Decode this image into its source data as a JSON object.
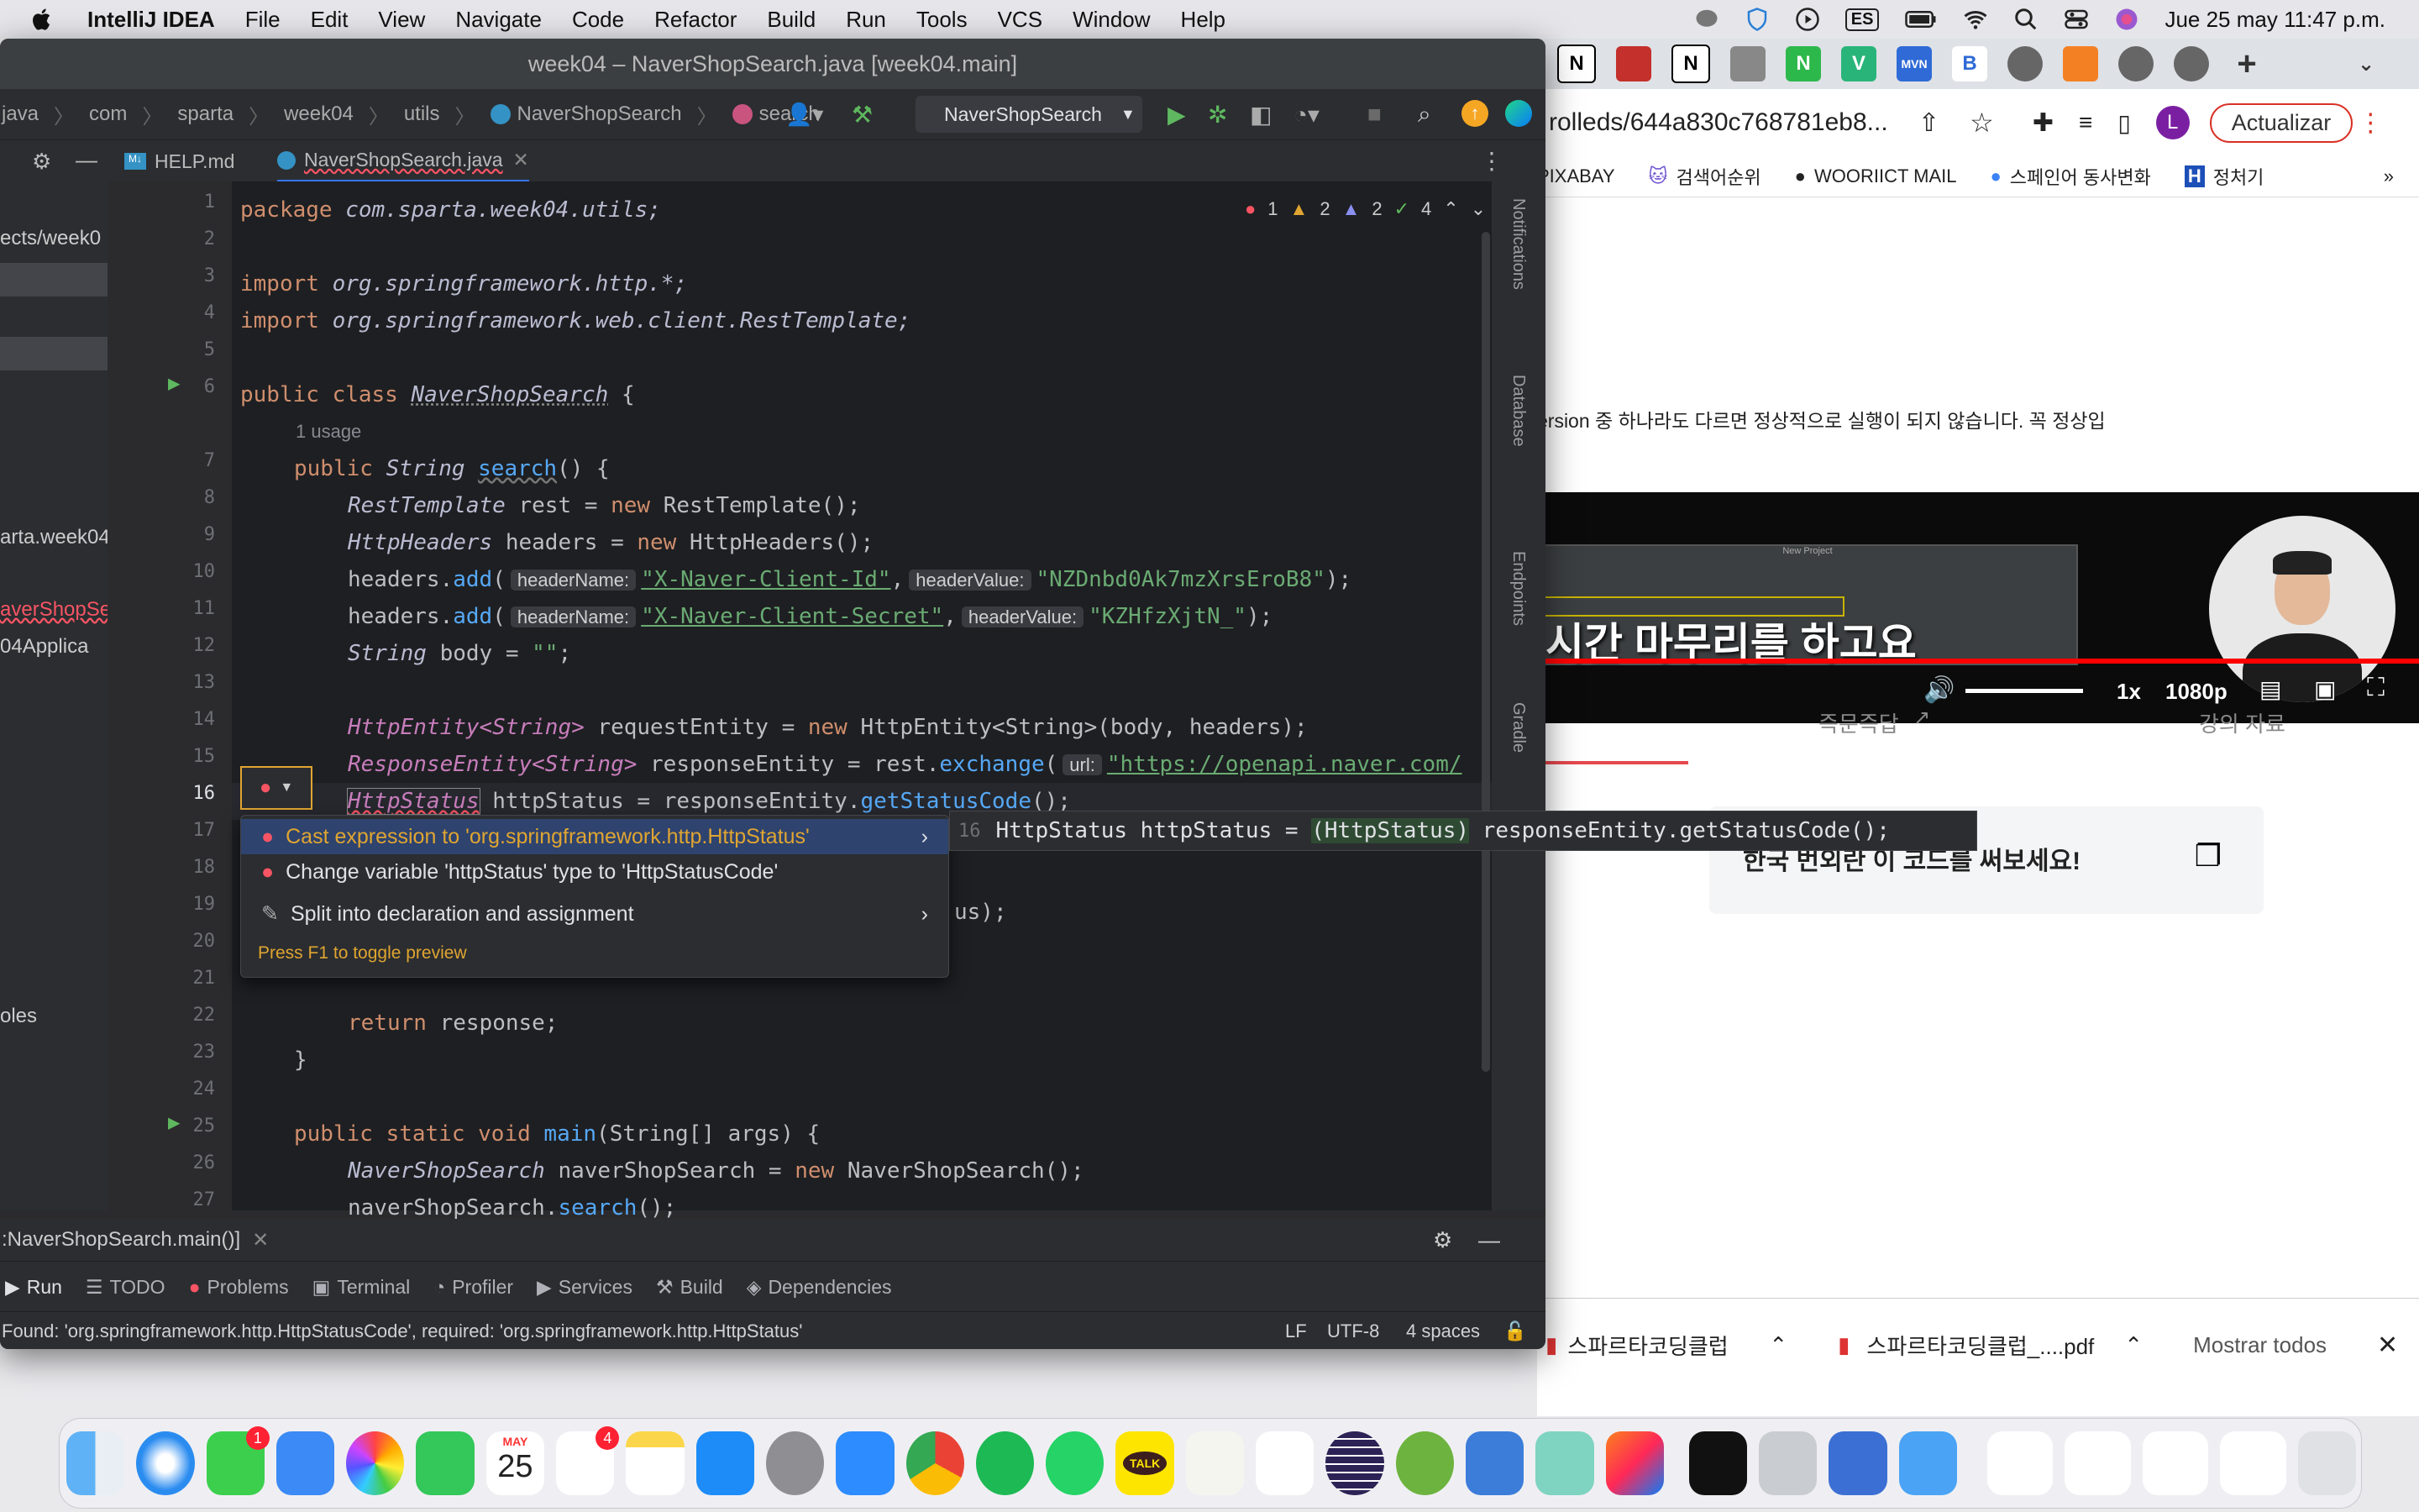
{
  "menubar": {
    "app_name": "IntelliJ IDEA",
    "items": [
      "File",
      "Edit",
      "View",
      "Navigate",
      "Code",
      "Refactor",
      "Build",
      "Run",
      "Tools",
      "VCS",
      "Window",
      "Help"
    ],
    "input_source": "ES",
    "datetime": "Jue 25 may  11:47 p.m."
  },
  "ide": {
    "window_title": "week04 – NaverShopSearch.java [week04.main]",
    "breadcrumbs": [
      "java",
      "com",
      "sparta",
      "week04",
      "utils",
      "NaverShopSearch",
      "search"
    ],
    "run_config": "NaverShopSearch",
    "tabs": [
      "HELP.md",
      "NaverShopSearch.java"
    ],
    "project_fragments": [
      "ects/week0",
      "arta.week04",
      "averShopSe",
      "04Applica",
      "oles"
    ],
    "inspection_counts": {
      "errors": "1",
      "warnings": "2",
      "weak": "2",
      "ok": "4"
    },
    "line_numbers": [
      "1",
      "2",
      "3",
      "4",
      "5",
      "6",
      "",
      "7",
      "8",
      "9",
      "10",
      "11",
      "12",
      "13",
      "14",
      "15",
      "16",
      "17",
      "18",
      "19",
      "20",
      "21",
      "22",
      "23",
      "24",
      "25",
      "26",
      "27"
    ],
    "code": {
      "l1_kw": "package",
      "l1_rest": " com.sparta.week04.utils;",
      "l3_kw": "import",
      "l3_rest": " org.springframework.http.*;",
      "l4_kw": "import",
      "l4_rest": " org.springframework.web.client.RestTemplate;",
      "l6_kw": "public class",
      "l6_name": "NaverShopSearch",
      "l6_rest": " {",
      "usage": "1 usage",
      "l7_kw": "public",
      "l7_type": " String ",
      "l7_fn": "search",
      "l7_rest": "() {",
      "l8_type": "RestTemplate",
      "l8_mid": " rest = ",
      "l8_kw": "new",
      "l8_rest": " RestTemplate();",
      "l9_type": "HttpHeaders",
      "l9_mid": " headers = ",
      "l9_kw": "new",
      "l9_rest": " HttpHeaders();",
      "l10_a": "headers.",
      "l10_fn": "add",
      "l10_b": "(",
      "l10_hint1": "headerName:",
      "l10_s1": "\"X-Naver-Client-Id\"",
      "l10_c": ",",
      "l10_hint2": "headerValue:",
      "l10_s2": "\"NZDnbd0Ak7mzXrsEroB8\"",
      "l10_d": ");",
      "l11_a": "headers.",
      "l11_fn": "add",
      "l11_b": "(",
      "l11_hint1": "headerName:",
      "l11_s1": "\"X-Naver-Client-Secret\"",
      "l11_c": ",",
      "l11_hint2": "headerValue:",
      "l11_s2": "\"KZHfzXjtN_\"",
      "l11_d": ");",
      "l12_type": "String",
      "l12_mid": " body = ",
      "l12_s": "\"\"",
      "l12_rest": ";",
      "l14_type": "HttpEntity<String>",
      "l14_mid": " requestEntity = ",
      "l14_kw": "new",
      "l14_rest": " HttpEntity<String>(body, headers);",
      "l15_type": "ResponseEntity<String>",
      "l15_mid": " responseEntity = rest.",
      "l15_fn": "exchange",
      "l15_b": "(",
      "l15_hint": "url:",
      "l15_s": "\"https://openapi.naver.com/",
      "l16_type": "HttpStatus",
      "l16_mid": " httpStatus = responseEntity.",
      "l16_fn": "getStatusCode",
      "l16_rest": "();",
      "l19_frag": "us);",
      "l22_kw": "return",
      "l22_rest": " response;",
      "l23": "}",
      "l25_kw": "public static void",
      "l25_fn": " main",
      "l25_rest": "(String[] args) {",
      "l26_type": "NaverShopSearch",
      "l26_mid": " naverShopSearch = ",
      "l26_kw": "new",
      "l26_rest": " NaverShopSearch();",
      "l27_a": "naverShopSearch.",
      "l27_fn": "search",
      "l27_rest": "();"
    },
    "popup": {
      "items": [
        "Cast expression to 'org.springframework.http.HttpStatus'",
        "Change variable 'httpStatus' type to 'HttpStatusCode'",
        "Split into declaration and assignment"
      ],
      "footer": "Press F1 to toggle preview"
    },
    "preview": {
      "line_no": "16",
      "before": "HttpStatus httpStatus = ",
      "cast": "(HttpStatus)",
      "after": " responseEntity.getStatusCode();"
    },
    "side_tools": [
      "Notifications",
      "Database",
      "Endpoints",
      "Gradle"
    ],
    "run_tab": ":NaverShopSearch.main()]",
    "tool_windows": [
      "Run",
      "TODO",
      "Problems",
      "Terminal",
      "Profiler",
      "Services",
      "Build",
      "Dependencies"
    ],
    "status_message": "Found: 'org.springframework.http.HttpStatusCode', required: 'org.springframework.http.HttpStatus'",
    "status_right": [
      "LF",
      "UTF-8",
      "4 spaces"
    ]
  },
  "browser": {
    "url": "rolleds/644a830c768781eb8...",
    "update_button": "Actualizar",
    "profile_initial": "L",
    "bookmarks": [
      "PIXABAY",
      "검색어순위",
      "WOORIICT MAIL",
      "스페인어 동사변화",
      "정처기"
    ],
    "page_text": "ersion 중 하나라도 다르면 정상적으로 실행이 되지 않습니다. 꼭 정상입",
    "video_caption": "시간 마무리를 하고요",
    "video_speed": "1x",
    "video_quality": "1080p",
    "video_inner_title": "New Project",
    "page_tabs": [
      "즉문즉답",
      "강의 자료"
    ],
    "card_text": "한국 번외란 이 코드를 써보세요!",
    "downloads": [
      "스파르타코딩클럽_....pdf",
      "스파르타코딩클럽_....pdf"
    ],
    "show_all": "Mostrar todos"
  },
  "dock": {
    "calendar_month": "MAY",
    "calendar_day": "25",
    "messages_badge": "1",
    "reminders_badge": "4",
    "talk_label": "TALK"
  },
  "colors": {
    "accent": "#3574f0",
    "error": "#f75464",
    "warning": "#e0a531",
    "youtube_red": "#ff0000"
  }
}
